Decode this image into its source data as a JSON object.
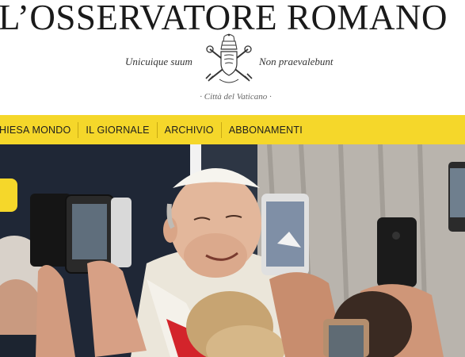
{
  "masthead": {
    "title": "L’OSSERVATORE ROMANO",
    "motto_left": "Unicuique suum",
    "motto_right": "Non praevalebunt",
    "city": "· Città del Vaticano ·",
    "crest_icon": "papal-coat-of-arms-icon"
  },
  "nav": {
    "items": [
      {
        "label": "HIESA MONDO"
      },
      {
        "label": "IL GIORNALE"
      },
      {
        "label": "ARCHIVIO"
      },
      {
        "label": "ABBONAMENTI"
      }
    ]
  },
  "hero": {
    "alt_icon": "hero-photo"
  },
  "colors": {
    "accent": "#f5d72a",
    "text": "#1a1a1a",
    "background": "#ffffff"
  }
}
